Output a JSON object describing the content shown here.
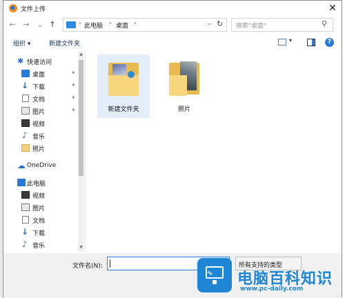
{
  "window": {
    "title": "文件上传",
    "close_glyph": "✕"
  },
  "navbar": {
    "back": "←",
    "forward": "→",
    "recent": "⌄",
    "up": "↑",
    "address": {
      "separator": "›",
      "crumbs": [
        "此电脑",
        "桌面"
      ],
      "dropdown": "⌄",
      "refresh": "↻"
    },
    "search": {
      "placeholder": "搜索\"桌面\"",
      "icon": "search-icon"
    }
  },
  "toolbar": {
    "organize": "组织 ▾",
    "new_folder": "新建文件夹",
    "view_caret": "▾",
    "help": "?"
  },
  "nav_pane": {
    "items": [
      {
        "label": "快速访问",
        "icon": "star-icon"
      },
      {
        "label": "桌面",
        "icon": "desktop-icon",
        "pinned": true
      },
      {
        "label": "下载",
        "icon": "download-icon",
        "pinned": true
      },
      {
        "label": "文档",
        "icon": "document-icon",
        "pinned": true
      },
      {
        "label": "图片",
        "icon": "picture-icon",
        "pinned": true
      },
      {
        "label": "视频",
        "icon": "video-icon"
      },
      {
        "label": "音乐",
        "icon": "music-icon"
      },
      {
        "label": "照片",
        "icon": "folder-icon"
      },
      {
        "label": "OneDrive",
        "icon": "cloud-icon"
      },
      {
        "label": "此电脑",
        "icon": "computer-icon"
      },
      {
        "label": "视频",
        "icon": "video-icon"
      },
      {
        "label": "图片",
        "icon": "picture-icon"
      },
      {
        "label": "文档",
        "icon": "document-icon"
      },
      {
        "label": "下载",
        "icon": "download-icon"
      },
      {
        "label": "音乐",
        "icon": "music-icon"
      }
    ],
    "pin_glyph": "✦",
    "scroll_up": "▲",
    "scroll_down": "▼"
  },
  "content": {
    "files": [
      {
        "name": "新建文件夹",
        "selected": true
      },
      {
        "name": "照片",
        "selected": false
      }
    ]
  },
  "bottom": {
    "filename_label": "文件名(N):",
    "filename_value": "",
    "filetype_value": "所有支持的类型"
  },
  "watermark": {
    "title": "电脑百科知识",
    "url": "www.pc-daily.com",
    "wave": "∿"
  },
  "colors": {
    "accent": "#2a7bd9",
    "folder": "#f7d67e",
    "selection": "#e3eefa"
  }
}
